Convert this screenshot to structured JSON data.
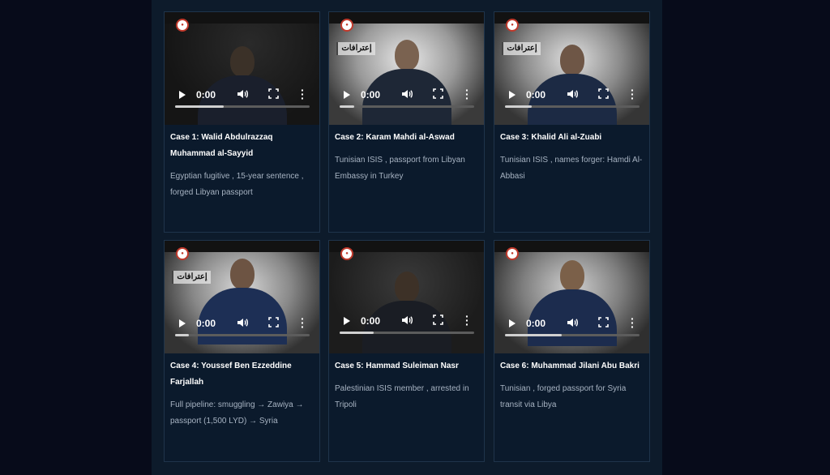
{
  "videos": [
    {
      "time": "0:00",
      "title": "Case 1: Walid Abdulrazzaq Muhammad al-Sayyid",
      "desc": "Egyptian fugitive , 15-year sentence , forged Libyan passport",
      "tag": "",
      "progress": 0.36
    },
    {
      "time": "0:00",
      "title": "Case 2: Karam Mahdi al-Aswad",
      "desc": "Tunisian ISIS , passport from Libyan Embassy in Turkey",
      "tag": "إعترافات",
      "progress": 0.11
    },
    {
      "time": "0:00",
      "title": "Case 3: Khalid Ali al-Zuabi",
      "desc": "Tunisian ISIS , names forger: Hamdi Al-Abbasi",
      "tag": "إعترافات",
      "progress": 0.2
    },
    {
      "time": "0:00",
      "title": "Case 4: Youssef Ben Ezzeddine Farjallah",
      "desc": "Full pipeline: smuggling → Zawiya → passport (1,500 LYD) → Syria",
      "tag": "إعترافات",
      "progress": 0.1
    },
    {
      "time": "0:00",
      "title": "Case 5: Hammad Suleiman Nasr",
      "desc": "Palestinian ISIS member , arrested in Tripoli",
      "tag": "",
      "progress": 0.25
    },
    {
      "time": "0:00",
      "title": "Case 6: Muhammad Jilani Abu Bakri",
      "desc": "Tunisian , forged passport for Syria transit via Libya",
      "tag": "",
      "progress": 0.42
    }
  ]
}
